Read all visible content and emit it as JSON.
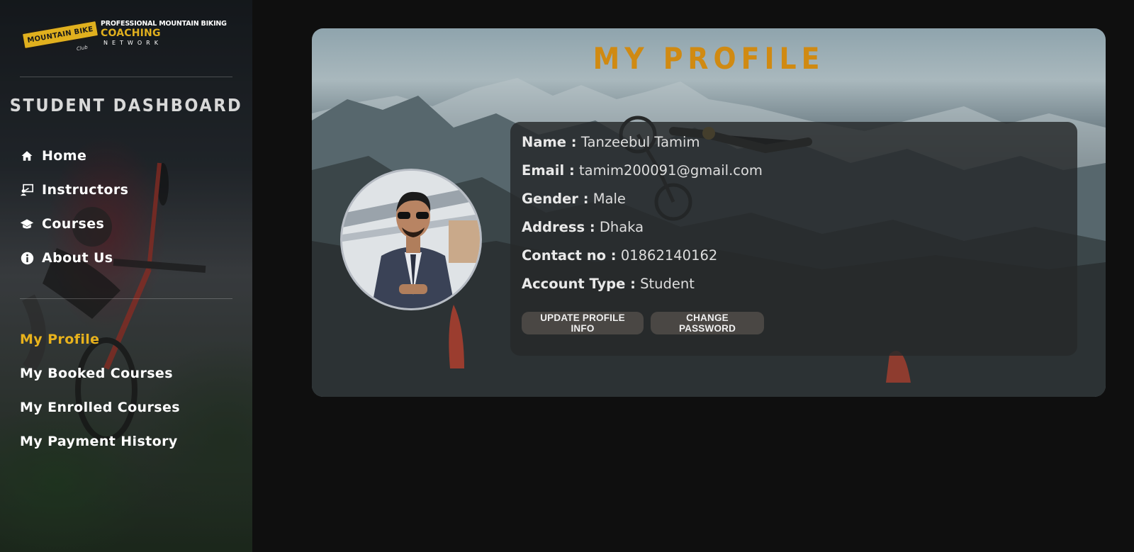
{
  "brand": {
    "badge": "MOUNTAIN BIKE",
    "club": "Club",
    "line1": "PROFESSIONAL MOUNTAIN BIKING",
    "line2": "COACHING",
    "line3": "NETWORK"
  },
  "sidebar": {
    "title": "STUDENT DASHBOARD",
    "main_nav": [
      {
        "label": "Home",
        "icon": "home-icon"
      },
      {
        "label": "Instructors",
        "icon": "instructor-icon"
      },
      {
        "label": "Courses",
        "icon": "graduation-cap-icon"
      },
      {
        "label": "About Us",
        "icon": "info-icon"
      }
    ],
    "user_nav": [
      {
        "label": "My Profile",
        "active": true
      },
      {
        "label": "My Booked Courses",
        "active": false
      },
      {
        "label": "My Enrolled Courses",
        "active": false
      },
      {
        "label": "My Payment History",
        "active": false
      }
    ]
  },
  "profile": {
    "title": "MY PROFILE",
    "fields": [
      {
        "label": "Name :",
        "value": "Tanzeebul Tamim"
      },
      {
        "label": "Email :",
        "value": "tamim200091@gmail.com"
      },
      {
        "label": "Gender :",
        "value": "Male"
      },
      {
        "label": "Address :",
        "value": "Dhaka"
      },
      {
        "label": "Contact no :",
        "value": "01862140162"
      },
      {
        "label": "Account Type :",
        "value": "Student"
      }
    ],
    "buttons": {
      "update": "UPDATE PROFILE INFO",
      "change_password": "CHANGE PASSWORD"
    }
  },
  "colors": {
    "accent": "#e8b21c",
    "title": "#d08a12",
    "background": "#0f0f0f"
  }
}
